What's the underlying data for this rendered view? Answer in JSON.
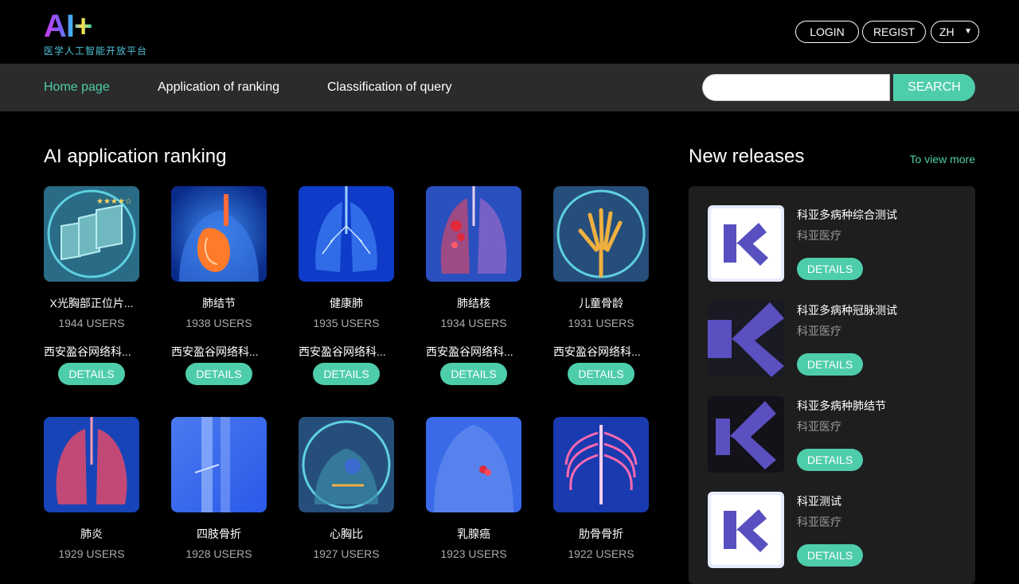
{
  "header": {
    "logo_text": "AI+",
    "logo_subtitle": "医学人工智能开放平台",
    "login_label": "LOGIN",
    "regist_label": "REGIST",
    "language": "ZH"
  },
  "nav": {
    "items": [
      {
        "label": "Home page",
        "active": true
      },
      {
        "label": "Application of ranking",
        "active": false
      },
      {
        "label": "Classification of query",
        "active": false
      }
    ],
    "search_placeholder": "",
    "search_label": "SEARCH"
  },
  "ranking": {
    "title": "AI application ranking",
    "apps": [
      {
        "name": "X光胸部正位片...",
        "users": "1944 USERS",
        "org": "西安盈谷网络科...",
        "details": "DETAILS",
        "icon": "film-scan-icon"
      },
      {
        "name": "肺结节",
        "users": "1938 USERS",
        "org": "西安盈谷网络科...",
        "details": "DETAILS",
        "icon": "lung-nodule-icon"
      },
      {
        "name": "健康肺",
        "users": "1935 USERS",
        "org": "西安盈谷网络科...",
        "details": "DETAILS",
        "icon": "healthy-lung-icon"
      },
      {
        "name": "肺结核",
        "users": "1934 USERS",
        "org": "西安盈谷网络科...",
        "details": "DETAILS",
        "icon": "tuberculosis-icon"
      },
      {
        "name": "儿童骨龄",
        "users": "1931 USERS",
        "org": "西安盈谷网络科...",
        "details": "DETAILS",
        "icon": "hand-bone-icon"
      },
      {
        "name": "肺炎",
        "users": "1929 USERS",
        "icon": "pneumonia-icon"
      },
      {
        "name": "四肢骨折",
        "users": "1928 USERS",
        "icon": "limb-fracture-icon"
      },
      {
        "name": "心胸比",
        "users": "1927 USERS",
        "icon": "heart-chest-icon"
      },
      {
        "name": "乳腺癌",
        "users": "1923 USERS",
        "icon": "breast-cancer-icon"
      },
      {
        "name": "肋骨骨折",
        "users": "1922 USERS",
        "icon": "rib-fracture-icon"
      }
    ]
  },
  "releases": {
    "title": "New releases",
    "view_more": "To view more",
    "items": [
      {
        "name": "科亚多病种综合测试",
        "org": "科亚医疗",
        "details": "DETAILS",
        "theme": "light"
      },
      {
        "name": "科亚多病种冠脉测试",
        "org": "科亚医疗",
        "details": "DETAILS",
        "theme": "dark"
      },
      {
        "name": "科亚多病种肺结节",
        "org": "科亚医疗",
        "details": "DETAILS",
        "theme": "dark"
      },
      {
        "name": "科亚测试",
        "org": "科亚医疗",
        "details": "DETAILS",
        "theme": "light"
      }
    ]
  },
  "colors": {
    "accent": "#4ecdab",
    "nav_bg": "#2b2b2b",
    "panel_bg": "#1e1e1e"
  }
}
